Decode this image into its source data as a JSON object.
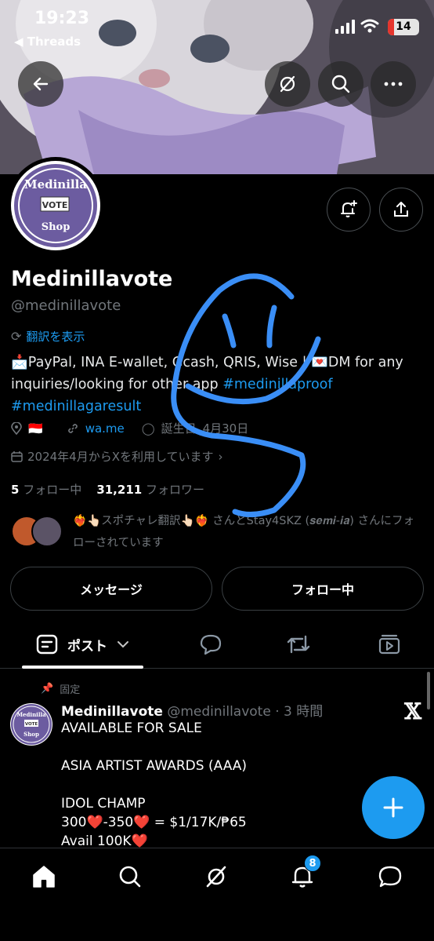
{
  "status_bar": {
    "time": "19:23",
    "back_app": "◀ Threads",
    "battery": "14"
  },
  "profile": {
    "name": "Medinillavote",
    "handle": "@medinillavote",
    "translate_label": "翻訳を表示",
    "bio_emoji_1": "📩",
    "bio_text_1": "PayPal, INA E-wallet, Gcash, QRIS, Wise | ",
    "bio_emoji_2": "💌",
    "bio_text_2": "DM for any inquiries/looking for other app ",
    "bio_tag_1": "#medinillaproof",
    "bio_tag_2": "#medinillagaresult",
    "location_flag": "🇮🇩",
    "website": "wa.me",
    "birthday_label": "誕生日",
    "birthday_value": "4月30日",
    "joined": "2024年4月からXを利用しています",
    "following_count": "5",
    "following_label": "フォロー中",
    "followers_count": "31,211",
    "followers_label": "フォロワー",
    "followed_by": "❤️‍🔥👆🏻スポチャレ翻訳👆🏻❤️‍🔥 さんとStay4SKZ (𝒔𝒆𝒎𝒊-𝒊𝒂) さんにフォローされています",
    "avatar_text": {
      "top": "Medinilla",
      "middle": "VOTE",
      "bottom": "Shop"
    }
  },
  "buttons": {
    "message": "メッセージ",
    "following": "フォロー中"
  },
  "tabs": {
    "posts": "ポスト"
  },
  "pinned_post": {
    "pinned_label": "固定",
    "author": "Medinillavote",
    "handle_time": "@medinillavote · 3 時間",
    "body": "AVAILABLE FOR SALE\n\nASIA ARTIST AWARDS (AAA)\n\nIDOL CHAMP\n300❤️-350❤️ = $1/17K/₱65\nAvail 100K❤️"
  },
  "nav": {
    "notification_count": "8"
  },
  "colors": {
    "accent": "#1d9bf0",
    "background": "#000000",
    "muted": "#71767b"
  }
}
